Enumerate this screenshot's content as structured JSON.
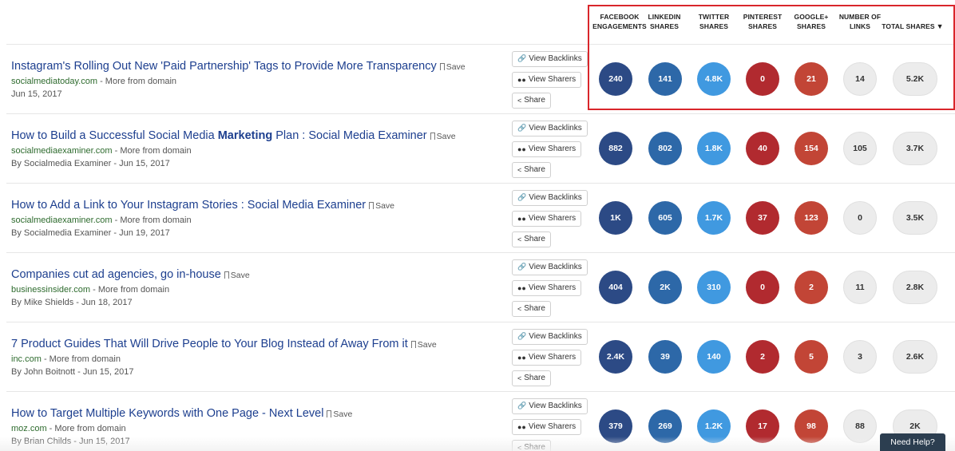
{
  "columns": [
    {
      "label": "FACEBOOK\nENGAGEMENTS"
    },
    {
      "label": "LINKEDIN\nSHARES"
    },
    {
      "label": "TWITTER\nSHARES"
    },
    {
      "label": "PINTEREST\nSHARES"
    },
    {
      "label": "GOOGLE+\nSHARES"
    },
    {
      "label": "NUMBER OF\nLINKS"
    },
    {
      "label": "TOTAL SHARES"
    }
  ],
  "buttons": {
    "view_backlinks": "View Backlinks",
    "view_sharers": "View Sharers",
    "share": "Share",
    "save": "Save"
  },
  "help": "Need Help?",
  "colors": {
    "facebook": "#2c4a85",
    "linkedin": "#2d68a8",
    "twitter": "#4099e0",
    "pinterest": "#b12a2f",
    "googleplus": "#c24536",
    "highlight": "#d9262b",
    "title_link": "#1d3f8f"
  },
  "articles": [
    {
      "title_pre": "Instagram's Rolling Out New 'Paid Partnership' Tags to Provide More Transparency",
      "title_bold": "",
      "title_post": "",
      "domain": "socialmediatoday.com",
      "more": " - More from domain",
      "byline": "Jun 15, 2017",
      "facebook": "240",
      "linkedin": "141",
      "twitter": "4.8K",
      "pinterest": "0",
      "googleplus": "21",
      "links": "14",
      "total": "5.2K"
    },
    {
      "title_pre": "How to Build a Successful Social Media ",
      "title_bold": "Marketing",
      "title_post": " Plan : Social Media Examiner",
      "domain": "socialmediaexaminer.com",
      "more": " - More from domain",
      "byline": "By Socialmedia Examiner - Jun 15, 2017",
      "facebook": "882",
      "linkedin": "802",
      "twitter": "1.8K",
      "pinterest": "40",
      "googleplus": "154",
      "links": "105",
      "total": "3.7K"
    },
    {
      "title_pre": "How to Add a Link to Your Instagram Stories : Social Media Examiner",
      "title_bold": "",
      "title_post": "",
      "domain": "socialmediaexaminer.com",
      "more": " - More from domain",
      "byline": "By Socialmedia Examiner - Jun 19, 2017",
      "facebook": "1K",
      "linkedin": "605",
      "twitter": "1.7K",
      "pinterest": "37",
      "googleplus": "123",
      "links": "0",
      "total": "3.5K"
    },
    {
      "title_pre": "Companies cut ad agencies, go in-house",
      "title_bold": "",
      "title_post": "",
      "domain": "businessinsider.com",
      "more": " - More from domain",
      "byline": "By Mike Shields - Jun 18, 2017",
      "facebook": "404",
      "linkedin": "2K",
      "twitter": "310",
      "pinterest": "0",
      "googleplus": "2",
      "links": "11",
      "total": "2.8K"
    },
    {
      "title_pre": "7 Product Guides That Will Drive People to Your Blog Instead of Away From it",
      "title_bold": "",
      "title_post": "",
      "domain": "inc.com",
      "more": " - More from domain",
      "byline": "By John Boitnott - Jun 15, 2017",
      "facebook": "2.4K",
      "linkedin": "39",
      "twitter": "140",
      "pinterest": "2",
      "googleplus": "5",
      "links": "3",
      "total": "2.6K"
    },
    {
      "title_pre": "How to Target Multiple Keywords with One Page - Next Level",
      "title_bold": "",
      "title_post": "",
      "domain": "moz.com",
      "more": " - More from domain",
      "byline": "By Brian Childs - Jun 15, 2017",
      "facebook": "379",
      "linkedin": "269",
      "twitter": "1.2K",
      "pinterest": "17",
      "googleplus": "98",
      "links": "88",
      "total": "2K"
    }
  ]
}
